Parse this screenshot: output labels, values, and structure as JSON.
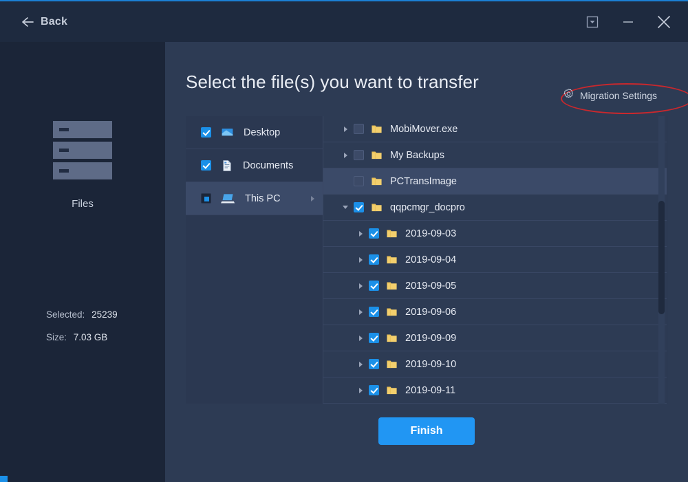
{
  "window": {
    "back_label": "Back",
    "controls": [
      {
        "name": "minimize-to-tray",
        "glyph": "tray"
      },
      {
        "name": "minimize",
        "glyph": "minimize"
      },
      {
        "name": "close",
        "glyph": "close"
      }
    ],
    "accent_color": "#1b7fd4"
  },
  "sidebar": {
    "category_label": "Files",
    "icon": "files-stack-icon",
    "stats": [
      {
        "key": "Selected:",
        "value": "25239"
      },
      {
        "key": "Size:",
        "value": "7.03 GB"
      }
    ]
  },
  "main": {
    "heading": "Select the file(s) you want to transfer",
    "migration_settings": {
      "label": "Migration Settings",
      "icon": "gear-icon",
      "annotation_color": "#c9282d"
    },
    "finish_label": "Finish"
  },
  "tree": {
    "items": [
      {
        "label": "Desktop",
        "icon": "desktop-icon",
        "check": "checked",
        "expandable": false,
        "selected": false
      },
      {
        "label": "Documents",
        "icon": "documents-icon",
        "check": "checked",
        "expandable": false,
        "selected": false
      },
      {
        "label": "This PC",
        "icon": "this-pc-icon",
        "check": "partial",
        "expandable": true,
        "selected": true
      }
    ]
  },
  "file_list": {
    "items": [
      {
        "label": "MobiMover.exe",
        "check": "unchecked",
        "arrow": "right",
        "indent": 0,
        "highlight": false,
        "icon": "folder-icon"
      },
      {
        "label": "My Backups",
        "check": "unchecked",
        "arrow": "right",
        "indent": 0,
        "highlight": false,
        "icon": "folder-icon"
      },
      {
        "label": "PCTransImage",
        "check": "unchecked",
        "arrow": "none",
        "indent": 0,
        "highlight": true,
        "icon": "folder-icon"
      },
      {
        "label": "qqpcmgr_docpro",
        "check": "checked",
        "arrow": "down",
        "indent": 0,
        "highlight": false,
        "icon": "folder-icon"
      },
      {
        "label": "2019-09-03",
        "check": "checked",
        "arrow": "right",
        "indent": 1,
        "highlight": false,
        "icon": "folder-icon"
      },
      {
        "label": "2019-09-04",
        "check": "checked",
        "arrow": "right",
        "indent": 1,
        "highlight": false,
        "icon": "folder-icon"
      },
      {
        "label": "2019-09-05",
        "check": "checked",
        "arrow": "right",
        "indent": 1,
        "highlight": false,
        "icon": "folder-icon"
      },
      {
        "label": "2019-09-06",
        "check": "checked",
        "arrow": "right",
        "indent": 1,
        "highlight": false,
        "icon": "folder-icon"
      },
      {
        "label": "2019-09-09",
        "check": "checked",
        "arrow": "right",
        "indent": 1,
        "highlight": false,
        "icon": "folder-icon"
      },
      {
        "label": "2019-09-10",
        "check": "checked",
        "arrow": "right",
        "indent": 1,
        "highlight": false,
        "icon": "folder-icon"
      },
      {
        "label": "2019-09-11",
        "check": "checked",
        "arrow": "right",
        "indent": 1,
        "highlight": false,
        "icon": "folder-icon"
      }
    ]
  }
}
